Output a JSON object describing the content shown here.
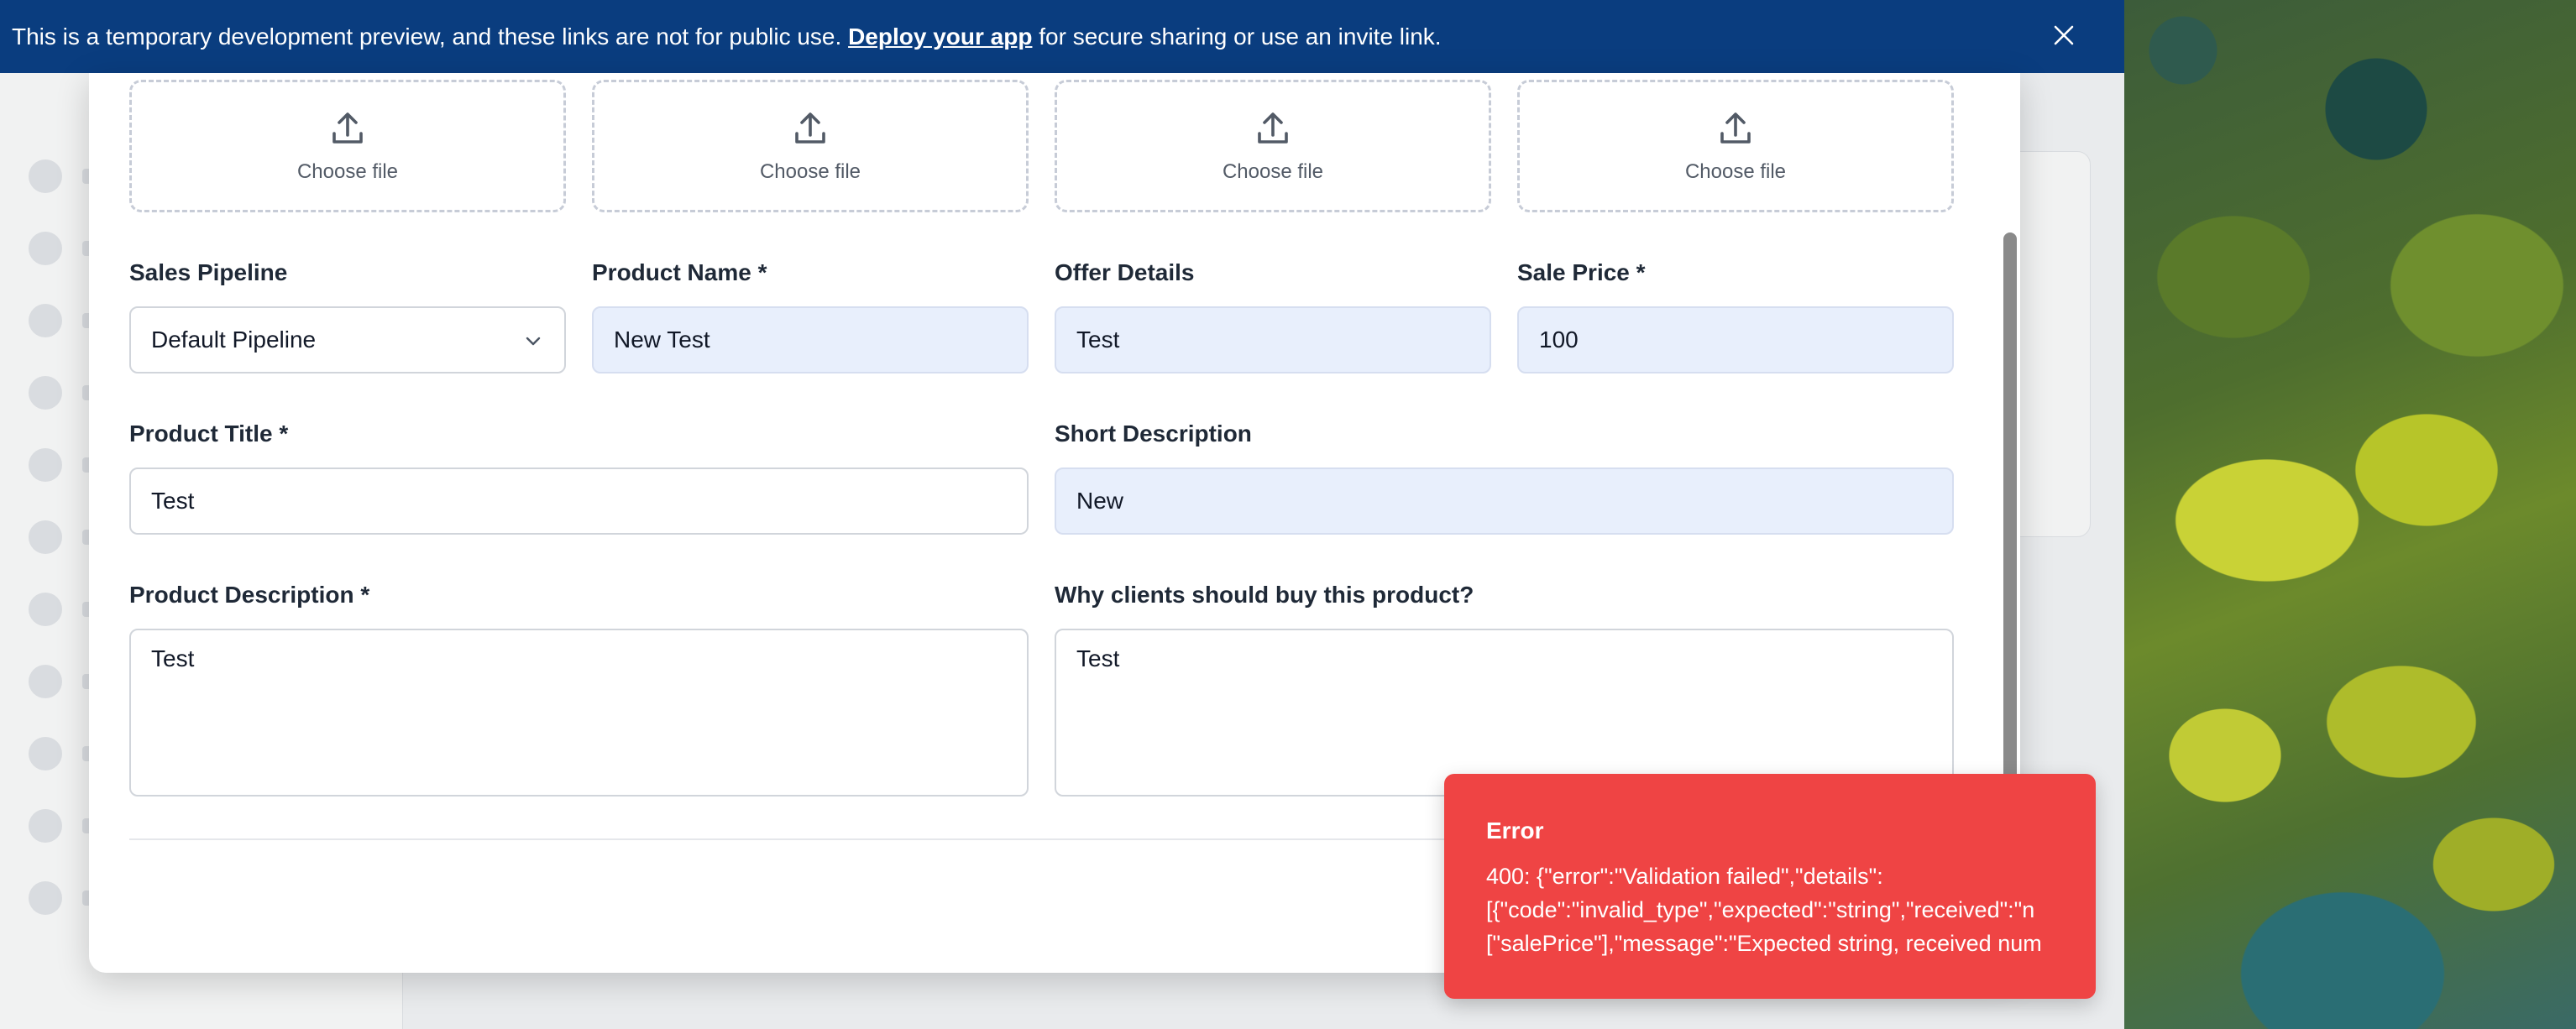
{
  "banner": {
    "text_before": "This is a temporary development preview, and these links are not for public use. ",
    "link_text": "Deploy your app",
    "text_after": " for secure sharing or use an invite link.",
    "close_icon": "close-icon"
  },
  "uploads": [
    {
      "label": "Choose file",
      "icon": "upload-icon"
    },
    {
      "label": "Choose file",
      "icon": "upload-icon"
    },
    {
      "label": "Choose file",
      "icon": "upload-icon"
    },
    {
      "label": "Choose file",
      "icon": "upload-icon"
    }
  ],
  "form": {
    "sales_pipeline": {
      "label": "Sales Pipeline",
      "value": "Default Pipeline"
    },
    "product_name": {
      "label": "Product Name *",
      "value": "New Test"
    },
    "offer_details": {
      "label": "Offer Details",
      "value": "Test"
    },
    "sale_price": {
      "label": "Sale Price *",
      "value": "100"
    },
    "product_title": {
      "label": "Product Title *",
      "value": "Test"
    },
    "short_description": {
      "label": "Short Description",
      "value": "New"
    },
    "product_description": {
      "label": "Product Description *",
      "value": "Test"
    },
    "why_buy": {
      "label": "Why clients should buy this product?",
      "value": "Test"
    }
  },
  "toast": {
    "title": "Error",
    "message": "400: {\"error\":\"Validation failed\",\"details\":\n[{\"code\":\"invalid_type\",\"expected\":\"string\",\"received\":\"n\n[\"salePrice\"],\"message\":\"Expected string, received num"
  },
  "colors": {
    "banner": "#0a3d7f",
    "toast": "#ef4444",
    "filled_field": "#e8effc"
  }
}
